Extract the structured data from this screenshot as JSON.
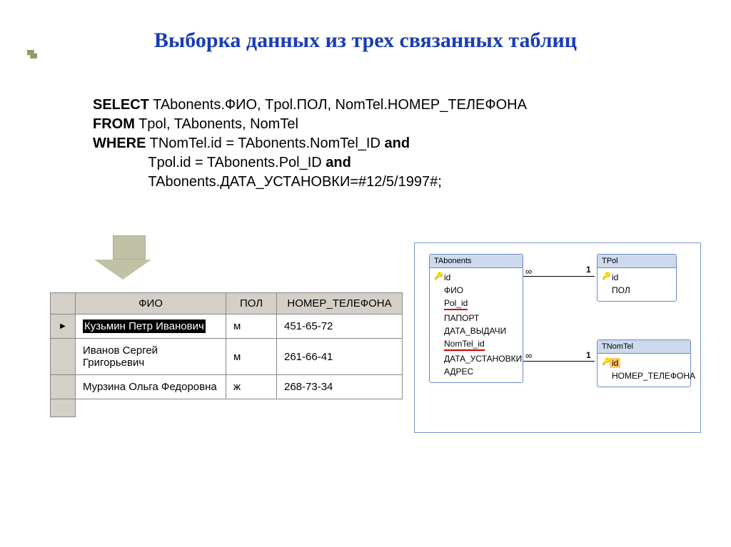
{
  "title": "Выборка данных из трех связанных таблиц",
  "sql": {
    "select_kw": "SELECT",
    "select_fields": " TAbonents.ФИО, Tpol.ПОЛ, NomTel.НОМЕР_ТЕЛЕФОНА",
    "from_kw": "FROM",
    "from_tables": " Tpol, TAbonents, NomTel",
    "where_kw": "WHERE",
    "where1": " TNomTel.id = TAbonents.NomTel_ID ",
    "and1": "and",
    "where2": "              Tpol.id = TAbonents.Pol_ID ",
    "and2": "and",
    "where3": "              TAbonents.ДАТА_УСТАНОВКИ=#12/5/1997#;"
  },
  "table": {
    "headers": [
      "ФИО",
      "ПОЛ",
      "НОМЕР_ТЕЛЕФОНА"
    ],
    "rows": [
      {
        "fio": "Кузьмин Петр Иванович",
        "pol": "м",
        "tel": "451-65-72",
        "selected": true
      },
      {
        "fio": "Иванов Сергей Григорьевич",
        "pol": "м",
        "tel": "261-66-41",
        "selected": false
      },
      {
        "fio": "Мурзина Ольга Федоровна",
        "pol": "ж",
        "tel": "268-73-34",
        "selected": false
      }
    ]
  },
  "diagram": {
    "box1": {
      "title": "TAbonents",
      "fields": [
        "id",
        "ФИО",
        "Pol_id",
        "ПАПОРТ",
        "ДАТА_ВЫДАЧИ",
        "NomTel_id",
        "ДАТА_УСТАНОВКИ",
        "АДРЕС"
      ]
    },
    "box2": {
      "title": "TPol",
      "fields": [
        "id",
        "ПОЛ"
      ]
    },
    "box3": {
      "title": "TNomTel",
      "fields": [
        "id",
        "НОМЕР_ТЕЛЕФОНА"
      ]
    },
    "inf": "∞",
    "one": "1"
  }
}
